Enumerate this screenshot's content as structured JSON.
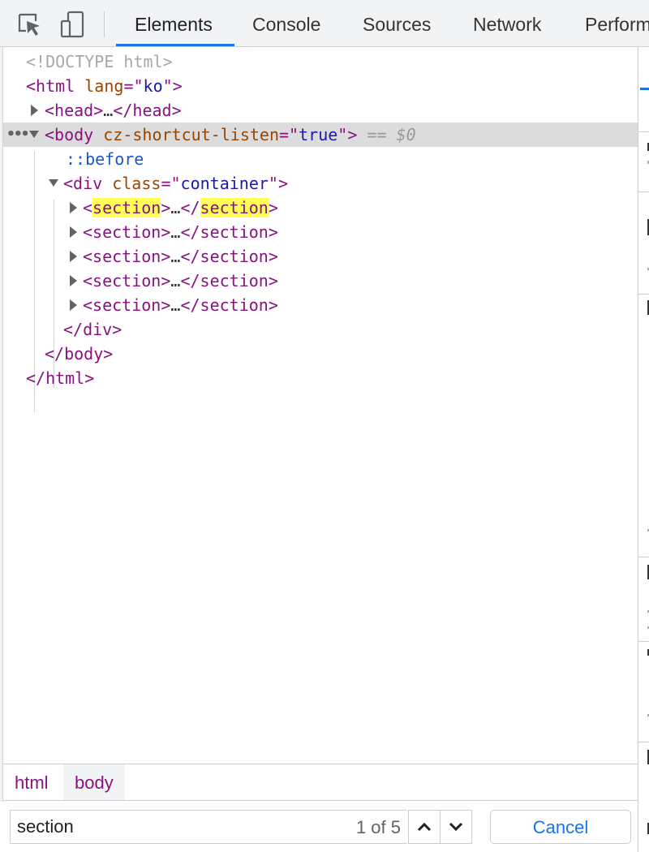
{
  "toolbar": {
    "inspect_icon": "inspect-element-icon",
    "device_icon": "device-toolbar-icon",
    "tabs": [
      "Elements",
      "Console",
      "Sources",
      "Network",
      "Perform"
    ],
    "active_tab": "Elements"
  },
  "dom_tree": {
    "doctype": "<!DOCTYPE html>",
    "html_tag": "html",
    "html_attr_name": "lang",
    "html_attr_value": "ko",
    "head_tag": "head",
    "body_tag": "body",
    "body_attr_name": "cz-shortcut-listen",
    "body_attr_value": "true",
    "selected_marker": "== $0",
    "pseudo_before": "::before",
    "div_tag": "div",
    "div_attr_name": "class",
    "div_attr_value": "container",
    "section_tag": "section",
    "section_count": 5,
    "ellipsis": "…",
    "close_div": "div",
    "close_body": "body",
    "close_html": "html",
    "search_highlight": "section"
  },
  "breadcrumbs": [
    "html",
    "body"
  ],
  "search": {
    "query": "section",
    "match_count": "1 of 5",
    "cancel_label": "Cancel"
  },
  "colors": {
    "tag": "#881280",
    "attr_name": "#994500",
    "attr_value": "#1a1aa6",
    "highlight": "#ffff55",
    "accent": "#1a73e8"
  }
}
